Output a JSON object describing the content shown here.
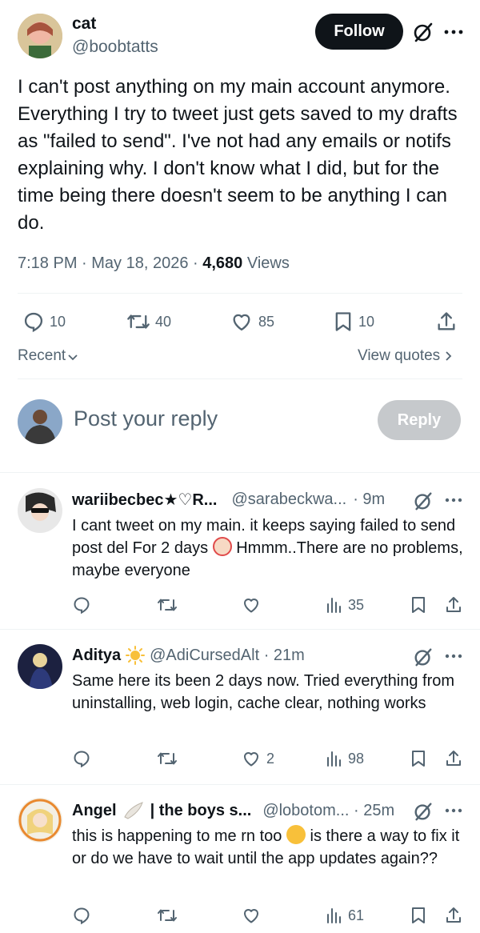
{
  "tweet": {
    "author_name": "cat",
    "author_handle": "@boobtatts",
    "follow_label": "Follow",
    "text": "I can't post anything on my main account anymore. Everything I try to tweet just gets saved to my drafts as \"failed to send\". I've not had any emails or notifs explaining why. I don't know what I did, but for the time being there doesn't seem to be anything I can do.",
    "time": "7:18 PM · May 18, 2026 · ",
    "views_count": "4,680",
    "views_label": " Views",
    "replies": "10",
    "retweets": "40",
    "likes": "85",
    "bookmarks": "10"
  },
  "sort": {
    "recent_label": "Recent",
    "view_quotes_label": "View quotes"
  },
  "composer": {
    "placeholder": "Post your reply",
    "reply_button": "Reply"
  },
  "replies": [
    {
      "name": "wariibecbec★♡R...",
      "handle": "@sarabeckwa...",
      "time": "· 9m",
      "text_a": "I cant tweet on my main. it keeps saying failed to send post del For 2 days ",
      "text_b": " Hmmm..There are no problems, maybe everyone",
      "reply_count": "",
      "retweet_count": "",
      "like_count": "",
      "views": "35"
    },
    {
      "name": "Aditya",
      "handle": "@AdiCursedAlt · 21m",
      "text": "Same here its been 2 days now. Tried everything from uninstalling, web login, cache clear, nothing works",
      "like_count": "2",
      "views": "98"
    },
    {
      "name": "Angel",
      "name_suffix": "| the boys s...",
      "handle": "@lobotom... · 25m",
      "text_a": "this is happening to me rn too ",
      "text_b": " is there a way to fix it or do we have to wait until the app updates again??",
      "views": "61"
    }
  ],
  "colors": {
    "primary_text": "#0f1419",
    "secondary_text": "#536471",
    "follow_bg": "#0f1419",
    "reply_btn_bg": "#c6c9cc",
    "divider": "#eff3f4"
  }
}
